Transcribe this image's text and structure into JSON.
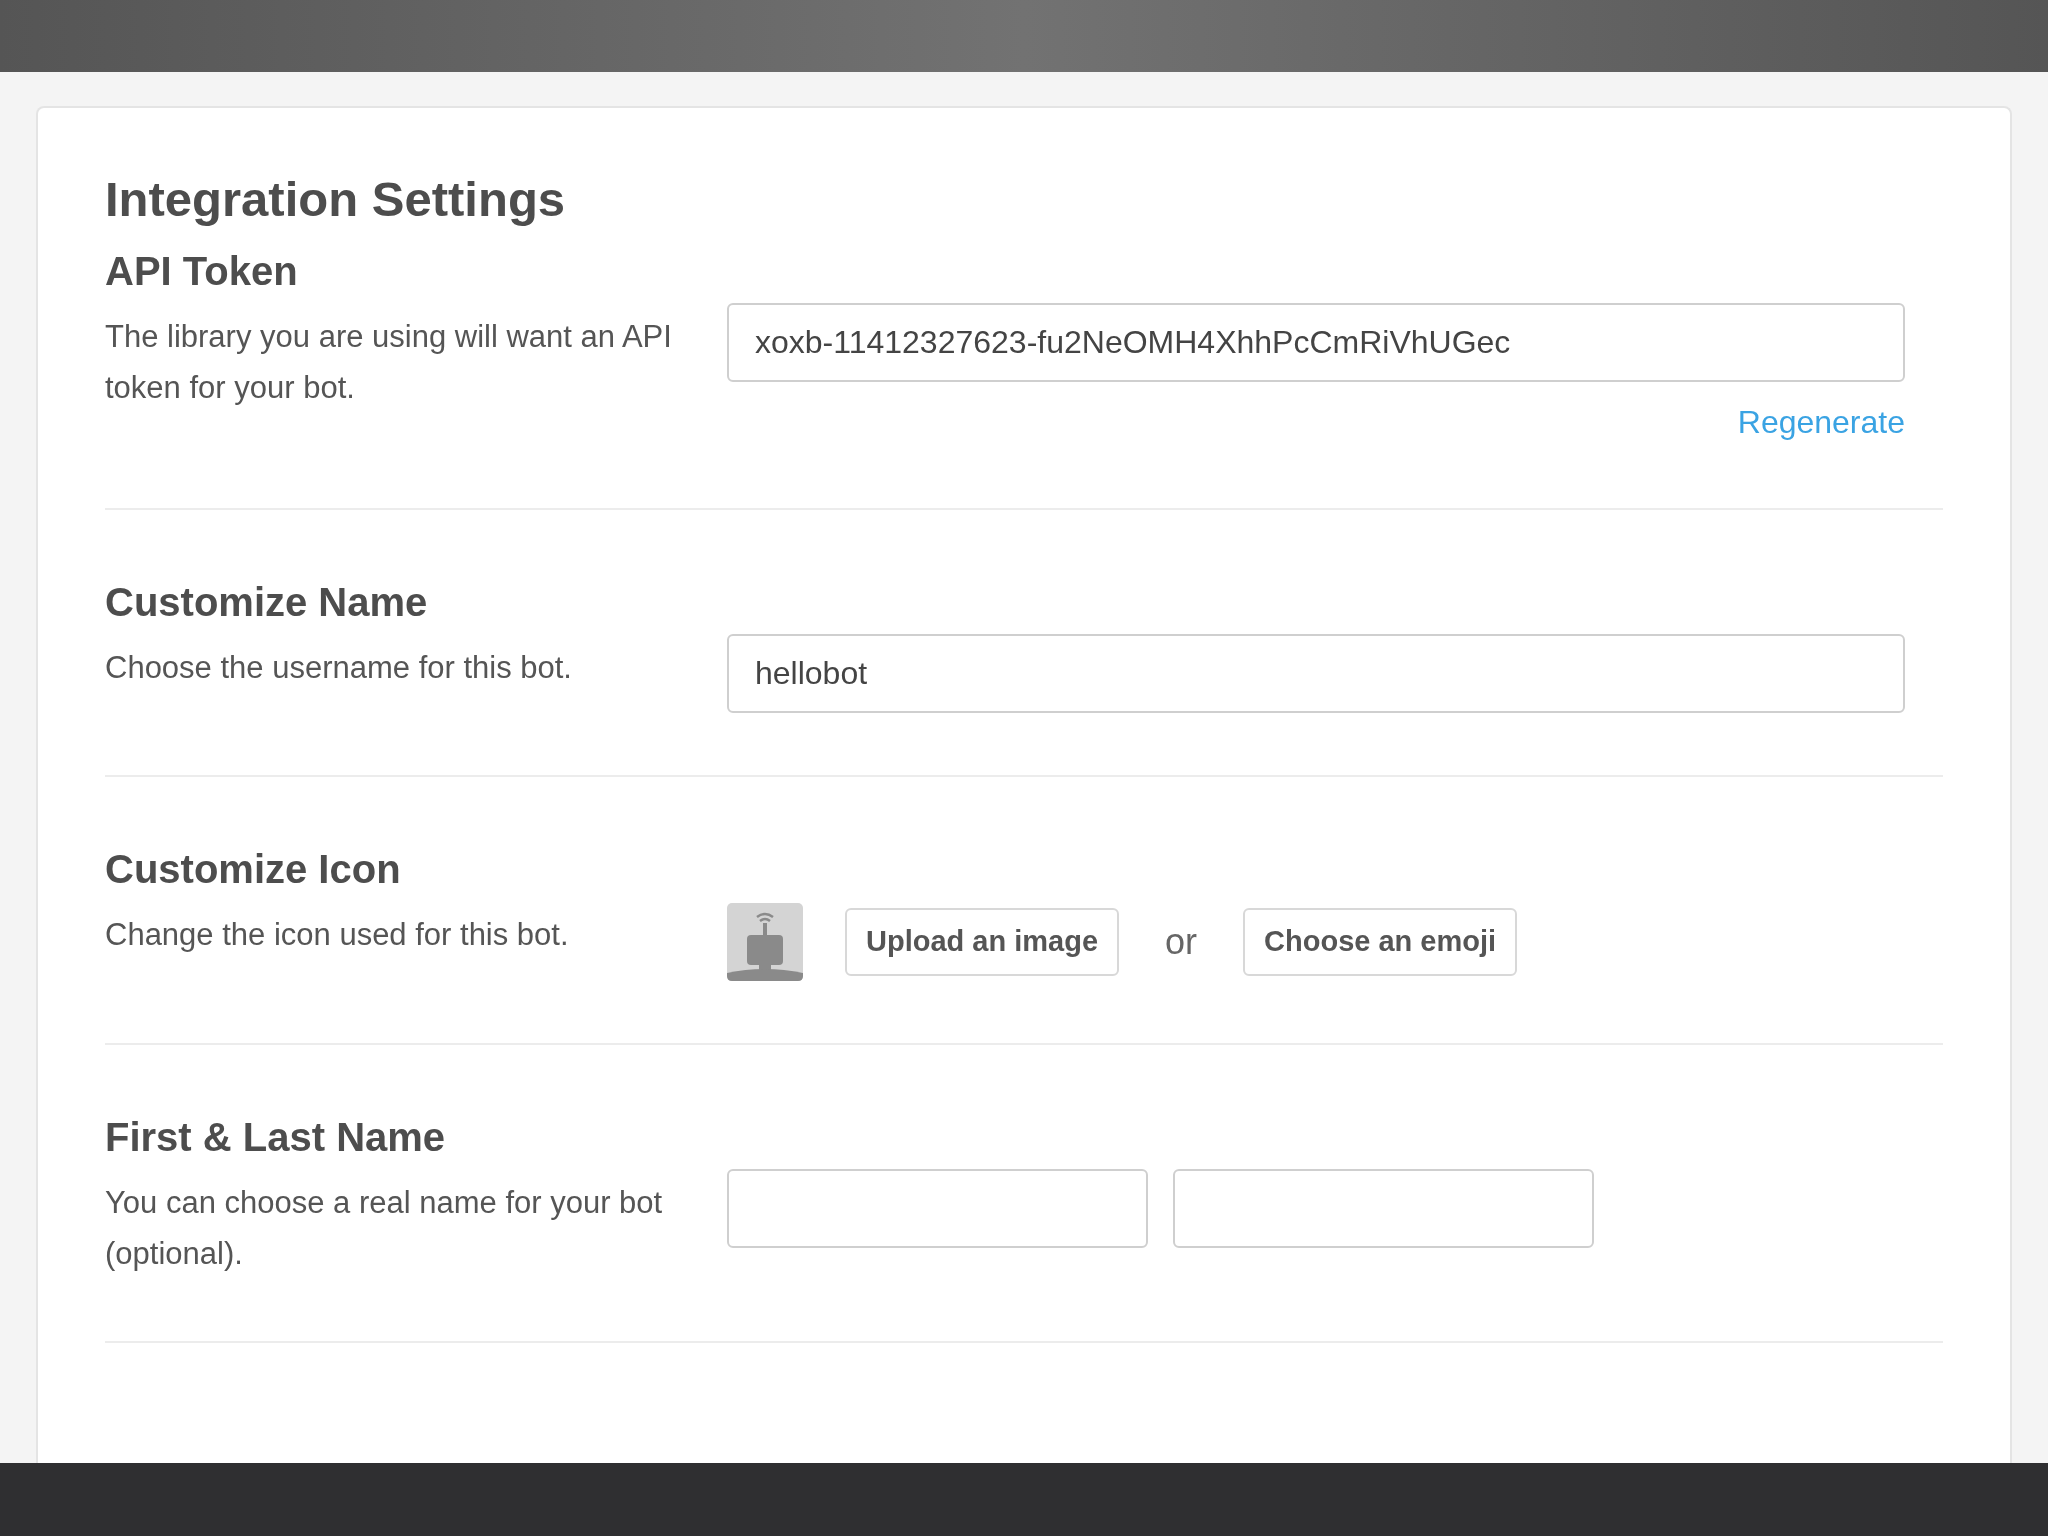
{
  "title": "Integration Settings",
  "sections": [
    {
      "kind": "token",
      "heading": "API Token",
      "description": "The library you are using will want an API token for your bot.",
      "inputs": [
        {
          "value": "xoxb-11412327623-fu2NeOMH4XhhPcCmRiVhUGec"
        }
      ],
      "link": "Regenerate"
    },
    {
      "kind": "name",
      "heading": "Customize Name",
      "description": "Choose the username for this bot.",
      "inputs": [
        {
          "value": "hellobot"
        }
      ]
    },
    {
      "kind": "icon",
      "heading": "Customize Icon",
      "description": "Change the icon used for this bot.",
      "buttons": [
        "Upload an image",
        "Choose an emoji"
      ],
      "separator": "or"
    },
    {
      "kind": "names",
      "heading": "First & Last Name",
      "description": "You can choose a real name for your bot (optional).",
      "inputs": [
        {
          "kind": "empty"
        },
        {
          "kind": "empty"
        }
      ]
    }
  ]
}
